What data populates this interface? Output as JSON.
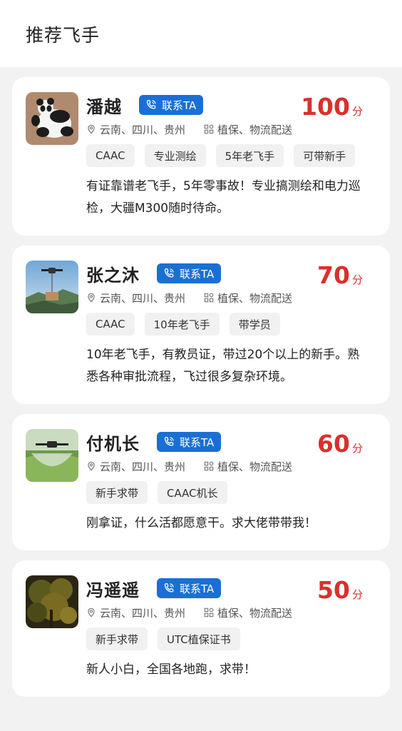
{
  "header": {
    "title": "推荐飞手"
  },
  "contact_label": "联系TA",
  "score_unit": "分",
  "pilots": [
    {
      "name": "潘越",
      "score": "100",
      "regions": "云南、四川、贵州",
      "services": "植保、物流配送",
      "tags": [
        "CAAC",
        "专业测绘",
        "5年老飞手",
        "可带新手"
      ],
      "desc": "有证靠谱老飞手，5年零事故！专业搞测绘和电力巡检，大疆M300随时待命。",
      "avatar": "panda"
    },
    {
      "name": "张之沐",
      "score": "70",
      "regions": "云南、四川、贵州",
      "services": "植保、物流配送",
      "tags": [
        "CAAC",
        "10年老飞手",
        "带学员"
      ],
      "desc": "10年老飞手，有教员证，带过20个以上的新手。熟悉各种审批流程，飞过很多复杂环境。",
      "avatar": "drone-delivery"
    },
    {
      "name": "付机长",
      "score": "60",
      "regions": "云南、四川、贵州",
      "services": "植保、物流配送",
      "tags": [
        "新手求带",
        "CAAC机长"
      ],
      "desc": "刚拿证，什么活都愿意干。求大佬带带我！",
      "avatar": "drone-spraying"
    },
    {
      "name": "冯遥遥",
      "score": "50",
      "regions": "云南、四川、贵州",
      "services": "植保、物流配送",
      "tags": [
        "新手求带",
        "UTC植保证书"
      ],
      "desc": "新人小白，全国各地跑，求带！",
      "avatar": "forest"
    }
  ],
  "colors": {
    "accent": "#1a6fd6",
    "score": "#d9302c"
  }
}
